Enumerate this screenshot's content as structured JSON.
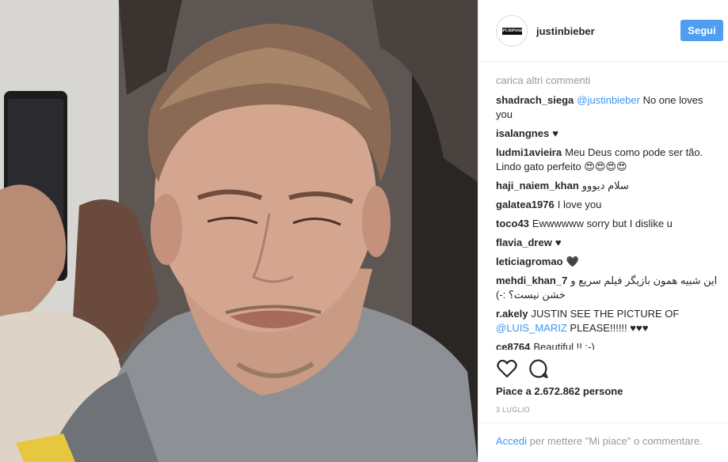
{
  "post": {
    "username": "justinbieber",
    "avatar_text": "PURPOSE TOUR",
    "follow_label": "Segui"
  },
  "comments": {
    "load_more": "carica altri commenti",
    "items": [
      {
        "user": "shadrach_siega",
        "mention": "@justinbieber",
        "text": " No one loves you"
      },
      {
        "user": "isalangnes",
        "text": "♥"
      },
      {
        "user": "ludmi1avieira",
        "text": "Meu Deus como pode ser tão. Lindo gato perfeito 😍😍😍😍"
      },
      {
        "user": "haji_naiem_khan",
        "text": "سلام دیووو"
      },
      {
        "user": "galatea1976",
        "text": "I love you"
      },
      {
        "user": "toco43",
        "text": "Ewwwwww sorry but I dislike u"
      },
      {
        "user": "flavia_drew",
        "text": "♥"
      },
      {
        "user": "leticiagromao",
        "text": "🖤"
      },
      {
        "user": "mehdi_khan_7",
        "text": "این شبیه همون بازیگر فیلم سریع و خشن نیست؟ :-)"
      },
      {
        "user": "r.akely",
        "text": "JUSTIN SEE THE PICTURE OF ",
        "mention": "@LUIS_MARIZ",
        "text2": " PLEASE!!!!!! ♥♥♥"
      },
      {
        "user": "ce8764",
        "text": "Beautiful !! :-)"
      }
    ]
  },
  "actions": {
    "like_icon": "heart-outline-icon",
    "comment_icon": "speech-bubble-icon"
  },
  "likes_text": "Piace a 2.672.862 persone",
  "date": "3 LUGLIO",
  "login": {
    "link": "Accedi",
    "text": " per mettere \"Mi piace\" o commentare."
  }
}
